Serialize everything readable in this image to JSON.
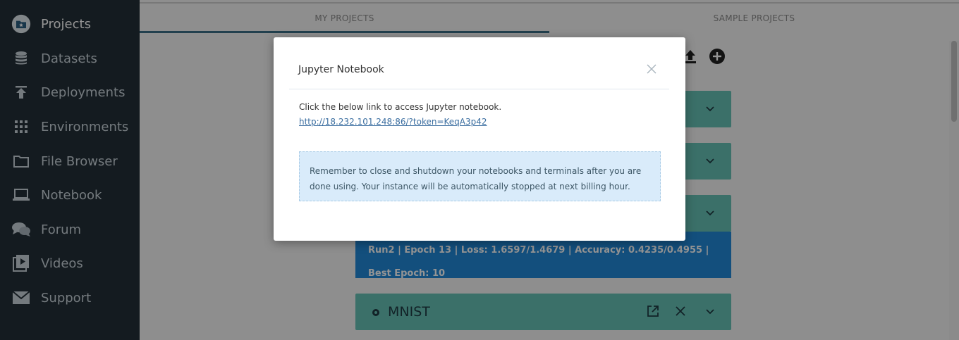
{
  "sidebar": {
    "items": [
      {
        "label": "Projects",
        "icon": "projects-folder-icon"
      },
      {
        "label": "Datasets",
        "icon": "database-icon"
      },
      {
        "label": "Deployments",
        "icon": "upload-icon"
      },
      {
        "label": "Environments",
        "icon": "grid-icon"
      },
      {
        "label": "File Browser",
        "icon": "folder-icon"
      },
      {
        "label": "Notebook",
        "icon": "laptop-icon"
      },
      {
        "label": "Forum",
        "icon": "chat-icon"
      },
      {
        "label": "Videos",
        "icon": "video-icon"
      },
      {
        "label": "Support",
        "icon": "envelope-icon"
      }
    ]
  },
  "tabs": [
    {
      "label": "MY PROJECTS"
    },
    {
      "label": "SAMPLE PROJECTS"
    }
  ],
  "run_status": {
    "text": "Run2 | Epoch 13 | Loss: 1.6597/1.4679 | Accuracy: 0.4235/0.4955 | Best Epoch: 10"
  },
  "project_card": {
    "title": "MNIST"
  },
  "modal": {
    "title": "Jupyter Notebook",
    "intro": "Click the below link to access Jupyter notebook.",
    "link": "http://18.232.101.248:86/?token=KeqA3p42",
    "notice": "Remember to close and shutdown your notebooks and terminals after you are done using. Your instance will be automatically stopped at next billing hour."
  },
  "colors": {
    "sidebar_bg": "#232f37",
    "card_teal": "#66c2b6",
    "run_blue": "#2188d8",
    "tab_underline": "#3c6e87",
    "notice_bg": "#d9ebfa"
  }
}
